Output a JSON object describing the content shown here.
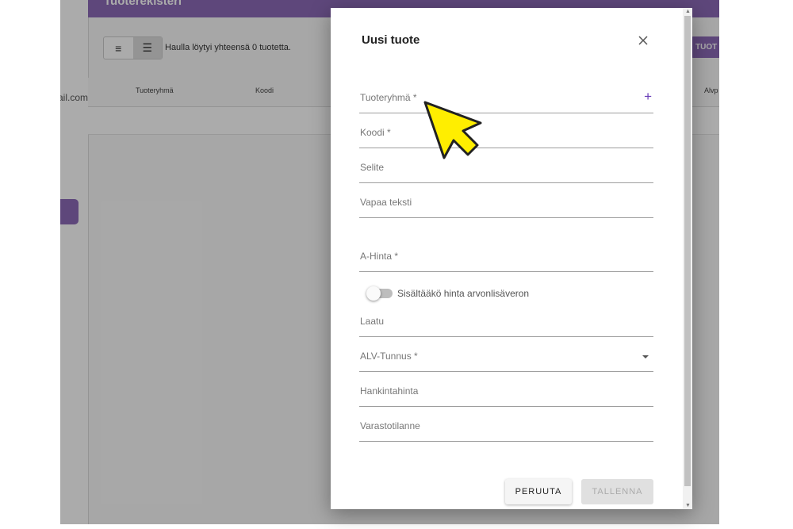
{
  "background": {
    "header_title": "Tuoterekisteri",
    "email_fragment": "ail.com",
    "result_text": "Haulla löytyi yhteensä 0 tuotetta.",
    "action_button": "TUOT",
    "columns": [
      "Tuoteryhmä",
      "Koodi",
      "Alvp"
    ]
  },
  "dialog": {
    "title": "Uusi tuote",
    "fields": {
      "tuoteryhma": "Tuoteryhmä *",
      "koodi": "Koodi *",
      "selite": "Selite",
      "vapaa_teksti": "Vapaa teksti",
      "a_hinta": "A-Hinta *",
      "laatu": "Laatu",
      "alv_tunnus": "ALV-Tunnus *",
      "hankintahinta": "Hankintahinta",
      "varastotilanne": "Varastotilanne"
    },
    "add_icon": "+",
    "toggle_label": "Sisältääkö hinta arvonlisäveron",
    "toggle_on": false,
    "cancel_label": "PERUUTA",
    "save_label": "TALLENNA"
  },
  "colors": {
    "accent": "#673ab7",
    "brand_purple": "#8c6bb8",
    "cursor_fill": "#ffee00"
  }
}
